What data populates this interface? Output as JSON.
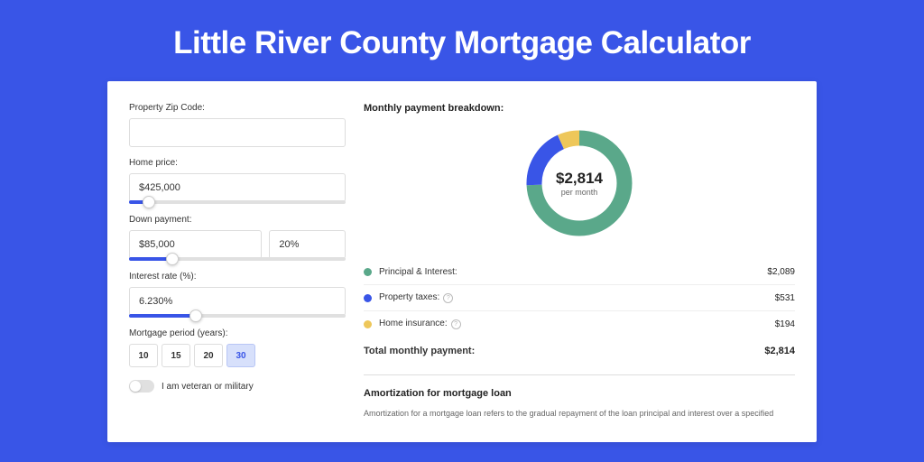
{
  "title": "Little River County Mortgage Calculator",
  "left": {
    "zip_label": "Property Zip Code:",
    "zip_value": "",
    "home_price_label": "Home price:",
    "home_price_value": "$425,000",
    "home_price_slider_pct": 9,
    "down_payment_label": "Down payment:",
    "down_payment_value": "$85,000",
    "down_payment_pct": "20%",
    "down_payment_slider_pct": 20,
    "interest_label": "Interest rate (%):",
    "interest_value": "6.230%",
    "interest_slider_pct": 31,
    "period_label": "Mortgage period (years):",
    "period_options": [
      "10",
      "15",
      "20",
      "30"
    ],
    "period_selected": "30",
    "veteran_label": "I am veteran or military"
  },
  "right": {
    "breakdown_title": "Monthly payment breakdown:",
    "total_amount": "$2,814",
    "per_month": "per month",
    "items": [
      {
        "label": "Principal & Interest:",
        "value": "$2,089",
        "color": "#5aa88a",
        "info": false
      },
      {
        "label": "Property taxes:",
        "value": "$531",
        "color": "#3955e7",
        "info": true
      },
      {
        "label": "Home insurance:",
        "value": "$194",
        "color": "#eec75a",
        "info": true
      }
    ],
    "total_label": "Total monthly payment:",
    "total_value": "$2,814",
    "amort_title": "Amortization for mortgage loan",
    "amort_text": "Amortization for a mortgage loan refers to the gradual repayment of the loan principal and interest over a specified"
  },
  "chart_data": {
    "type": "pie",
    "title": "Monthly payment breakdown",
    "categories": [
      "Principal & Interest",
      "Property taxes",
      "Home insurance"
    ],
    "values": [
      2089,
      531,
      194
    ],
    "colors": [
      "#5aa88a",
      "#3955e7",
      "#eec75a"
    ],
    "total": 2814
  }
}
